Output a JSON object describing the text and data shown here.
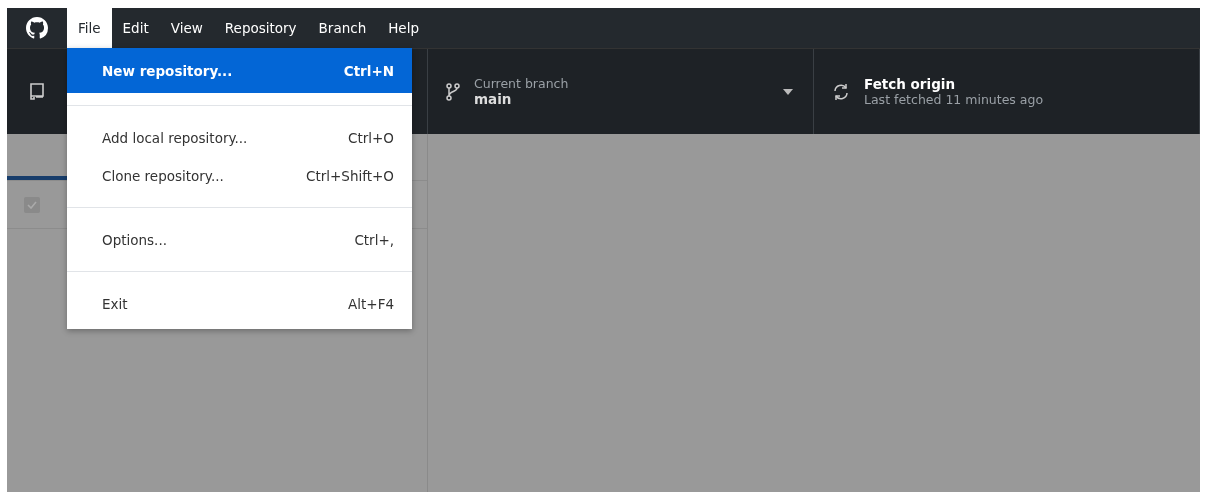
{
  "menubar": [
    {
      "label": "File",
      "selected": true
    },
    {
      "label": "Edit",
      "selected": false
    },
    {
      "label": "View",
      "selected": false
    },
    {
      "label": "Repository",
      "selected": false
    },
    {
      "label": "Branch",
      "selected": false
    },
    {
      "label": "Help",
      "selected": false
    }
  ],
  "file_menu": [
    {
      "kind": "item",
      "label": "New repository...",
      "shortcut": "Ctrl+N",
      "selected": true
    },
    {
      "kind": "separator"
    },
    {
      "kind": "item",
      "label": "Add local repository...",
      "shortcut": "Ctrl+O",
      "selected": false
    },
    {
      "kind": "item",
      "label": "Clone repository...",
      "shortcut": "Ctrl+Shift+O",
      "selected": false
    },
    {
      "kind": "separator"
    },
    {
      "kind": "item",
      "label": "Options...",
      "shortcut": "Ctrl+,",
      "selected": false
    },
    {
      "kind": "separator"
    },
    {
      "kind": "item",
      "label": "Exit",
      "shortcut": "Alt+F4",
      "selected": false
    }
  ],
  "toolbar": {
    "branch": {
      "label": "Current branch",
      "value": "main"
    },
    "fetch": {
      "title": "Fetch origin",
      "subtitle": "Last fetched 11 minutes ago"
    }
  },
  "changes": {
    "select_all_checked": true
  }
}
